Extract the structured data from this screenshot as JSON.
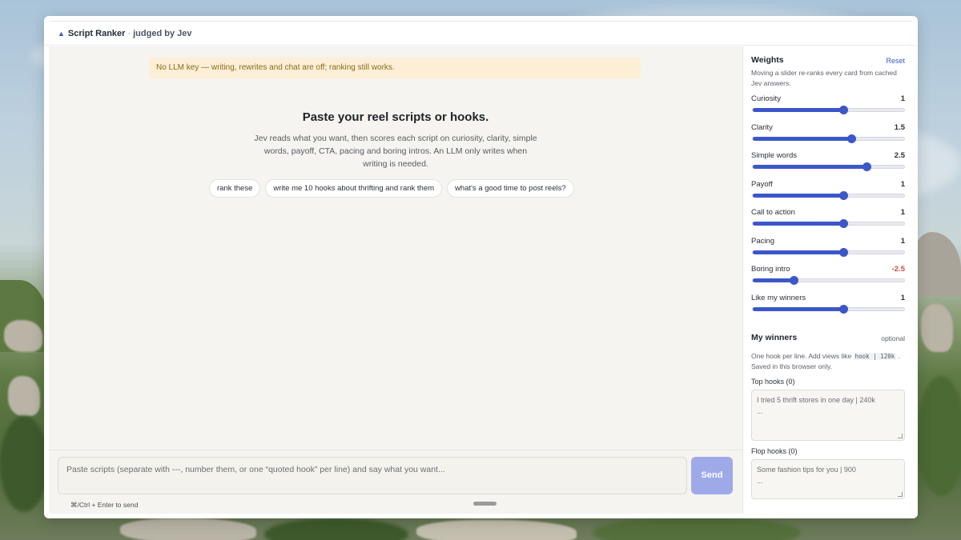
{
  "window": {
    "app_name": "Script Ranker",
    "separator": "·",
    "subtitle": "judged by Jev",
    "logo_icon": "triangle-icon"
  },
  "banner": {
    "text": "No LLM key — writing, rewrites and chat are off; ranking still works."
  },
  "hero": {
    "title": "Paste your reel scripts or hooks.",
    "description": "Jev reads what you want, then scores each script on curiosity, clarity, simple words, payoff, CTA, pacing and boring intros. An LLM only writes when writing is needed."
  },
  "chips": [
    "rank these",
    "write me 10 hooks about thrifting and rank them",
    "what's a good time to post reels?"
  ],
  "composer": {
    "placeholder": "Paste scripts (separate with ---, number them, or one “quoted hook” per line) and say what you want...",
    "send_label": "Send",
    "shortcut": "⌘/Ctrl + Enter to send"
  },
  "weights": {
    "title": "Weights",
    "reset_label": "Reset",
    "note": "Moving a slider re-ranks every card from cached Jev answers.",
    "sliders": [
      {
        "label": "Curiosity",
        "value": "1",
        "fraction": 0.6
      },
      {
        "label": "Clarity",
        "value": "1.5",
        "fraction": 0.65
      },
      {
        "label": "Simple words",
        "value": "2.5",
        "fraction": 0.75
      },
      {
        "label": "Payoff",
        "value": "1",
        "fraction": 0.6
      },
      {
        "label": "Call to action",
        "value": "1",
        "fraction": 0.6
      },
      {
        "label": "Pacing",
        "value": "1",
        "fraction": 0.6
      },
      {
        "label": "Boring intro",
        "value": "-2.5",
        "fraction": 0.27,
        "negative": true
      },
      {
        "label": "Like my winners",
        "value": "1",
        "fraction": 0.6
      }
    ],
    "accent_color": "#3b57c8",
    "negative_color": "#d24b3a"
  },
  "winners": {
    "title": "My winners",
    "optional_label": "optional",
    "note_prefix": "One hook per line. Add views like",
    "note_code": "hook | 120k",
    "note_suffix": ". Saved in this browser only.",
    "top_label": "Top hooks (0)",
    "top_placeholder": "I tried 5 thrift stores in one day | 240k",
    "top_ellipsis": "...",
    "flop_label": "Flop hooks (0)",
    "flop_placeholder": "Some fashion tips for you | 900",
    "flop_ellipsis": "..."
  }
}
